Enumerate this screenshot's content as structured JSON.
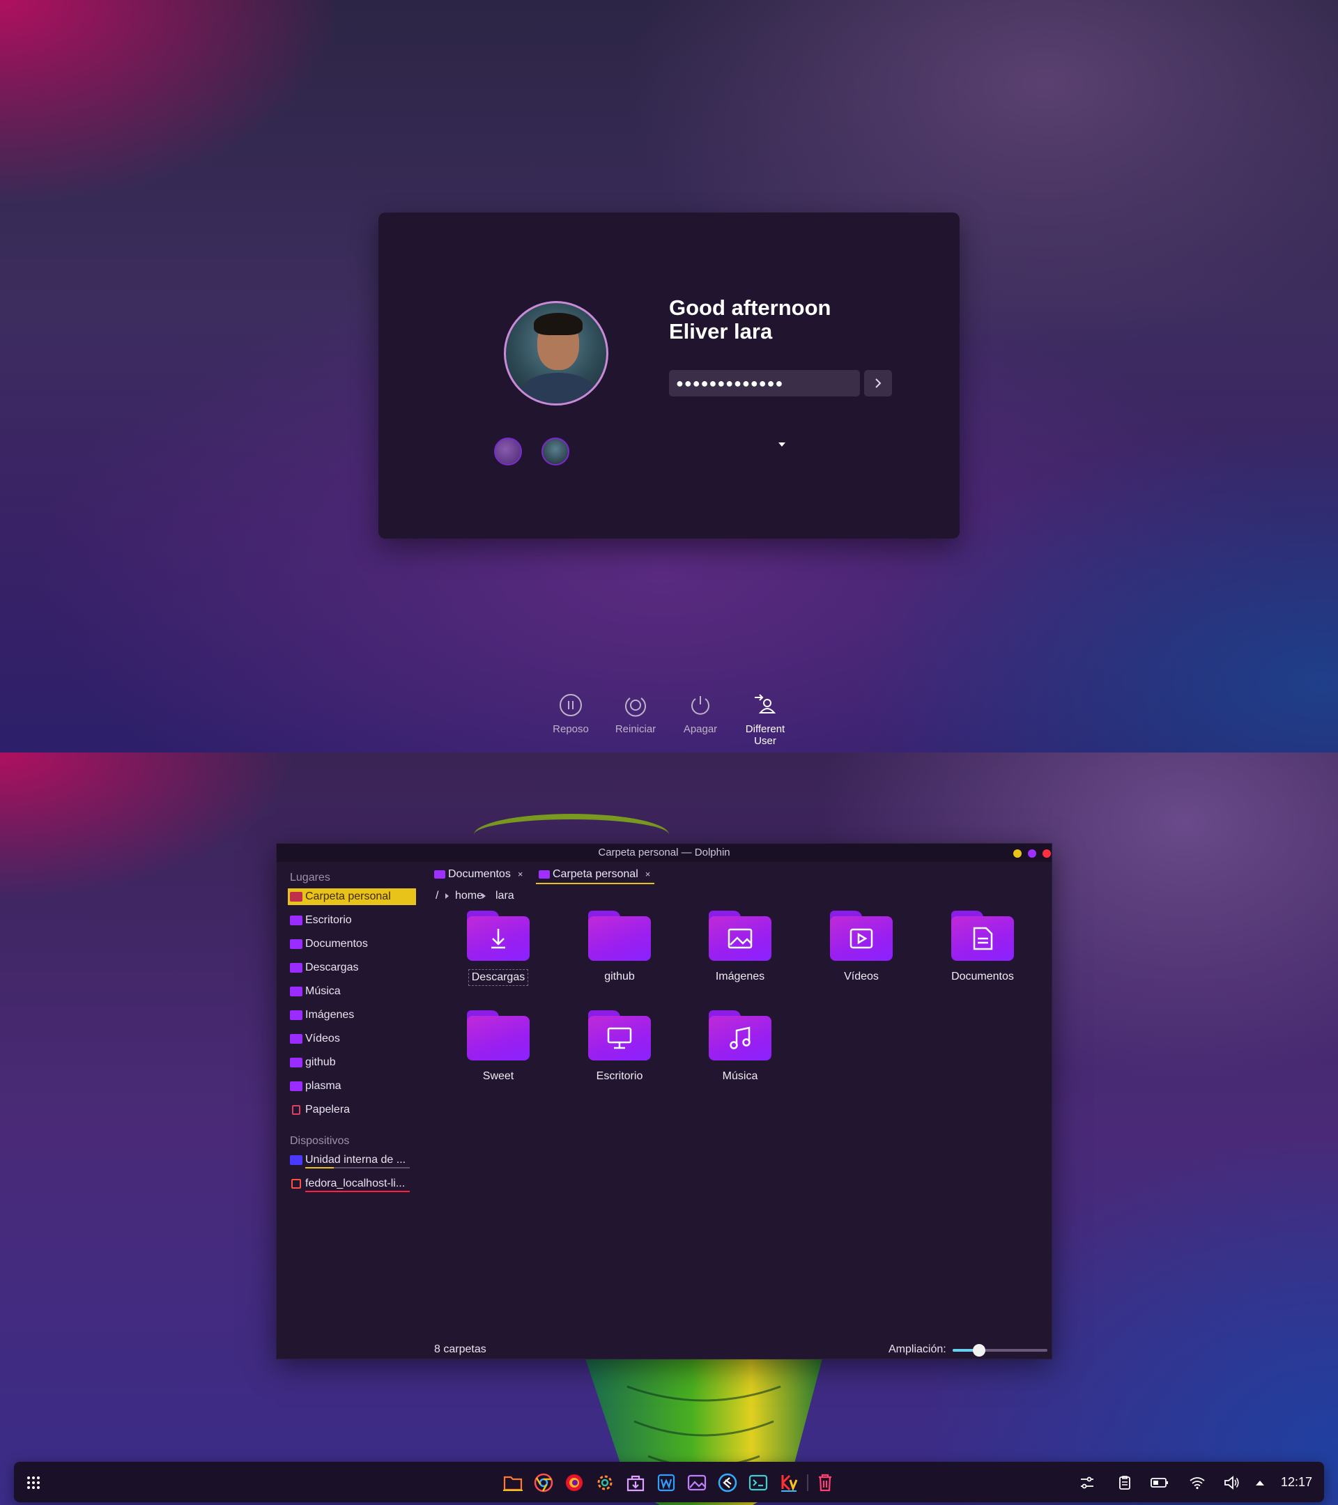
{
  "login": {
    "greeting_line1": "Good afternoon",
    "greeting_line2": "Eliver lara",
    "password_mask": "●●●●●●●●●●●●●",
    "actions": [
      {
        "label": "Reposo",
        "icon": "sleep-icon"
      },
      {
        "label": "Reiniciar",
        "icon": "restart-icon"
      },
      {
        "label": "Apagar",
        "icon": "power-icon"
      },
      {
        "label_line1": "Different",
        "label_line2": "User",
        "icon": "switch-user-icon"
      }
    ]
  },
  "dolphin": {
    "title": "Carpeta personal — Dolphin",
    "window_buttons": {
      "minimize": "#e8c41a",
      "maximize": "#a030ff",
      "close": "#ff3040"
    },
    "sidebar": {
      "places_header": "Lugares",
      "places": [
        "Carpeta personal",
        "Escritorio",
        "Documentos",
        "Descargas",
        "Música",
        "Imágenes",
        "Vídeos",
        "github",
        "plasma",
        "Papelera"
      ],
      "devices_header": "Dispositivos",
      "devices": [
        {
          "label": "Unidad interna de ...",
          "usage": 0.27,
          "bar_color": "#e8c41a"
        },
        {
          "label": "fedora_localhost-li...",
          "usage": 1.0,
          "bar_color": "#ff2040"
        }
      ]
    },
    "tabs": [
      {
        "label": "Documentos",
        "close": "×"
      },
      {
        "label": "Carpeta personal",
        "close": "×"
      }
    ],
    "breadcrumb": [
      "/",
      "home",
      "lara"
    ],
    "folders": [
      "Descargas",
      "github",
      "Imágenes",
      "Vídeos",
      "Documentos",
      "Sweet",
      "Escritorio",
      "Música"
    ],
    "status": "8 carpetas",
    "zoom_label": "Ampliación:",
    "zoom_level": 0.28
  },
  "taskbar": {
    "launcher_icon": "app-grid-icon",
    "apps": [
      "folder-icon",
      "chrome-icon",
      "firefox-icon",
      "settings-icon",
      "discover-icon",
      "writer-icon",
      "image-viewer-icon",
      "vscode-icon",
      "terminal-icon",
      "krita-icon",
      "trash-icon"
    ],
    "tray": [
      "sliders-icon",
      "clipboard-icon",
      "battery-icon",
      "wifi-icon",
      "volume-icon",
      "tray-expand-icon"
    ],
    "clock": "12:17",
    "accent": "#e8c41a"
  }
}
